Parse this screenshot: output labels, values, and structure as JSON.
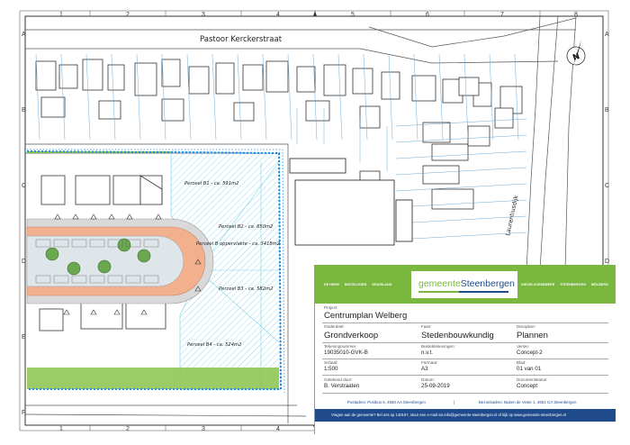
{
  "grid": {
    "cols": [
      "1",
      "2",
      "3",
      "4",
      "5",
      "6",
      "7",
      "8"
    ],
    "rows": [
      "A",
      "B",
      "C",
      "D",
      "E",
      "F"
    ]
  },
  "map": {
    "street_top": "Pastoor Kerckerstraat",
    "street_right": "Laurentiusdijk",
    "north": "N",
    "plots": {
      "b1": "Perceel B1 - ca. 591m2",
      "b2": "Perceel B2 - ca. 650m2",
      "b": "Perceel B oppervlakte - ca. 3418m2",
      "b3": "Perceel B3 - ca. 582m2",
      "b4": "Perceel B4 - ca. 524m2"
    },
    "colors": {
      "plot_outline": "#1e88e5",
      "hatch": "#7fd3e8",
      "green": "#8bc34a",
      "salmon": "#f2b08f"
    }
  },
  "titleblock": {
    "nav_left": [
      "DE HEEN",
      "DINTELOORD",
      "KRUISLAND"
    ],
    "nav_right": [
      "NIEUW-VOSSEMEER",
      "STEENBERGEN",
      "WELBERG"
    ],
    "logo_a": "gemeente",
    "logo_b": "Steenbergen",
    "project_label": "Project:",
    "project": "Centrumplan Welberg",
    "onderdeel_label": "Onderdeel:",
    "onderdeel": "Grondverkoop",
    "fase_label": "Fase:",
    "fase": "Stedenbouwkundig",
    "discipline_label": "Discipline:",
    "discipline": "Plannen",
    "tekening_label": "Tekeningnummer",
    "tekening": "19035010-GVK-B",
    "bestek_label": "Bestektekeningen:",
    "bestek": "n.v.t.",
    "versie_label": "Versie:",
    "versie": "Concept-2",
    "schaal_label": "Schaal:",
    "schaal": "1:500",
    "formaat_label": "Formaat:",
    "formaat": "A3",
    "blad_label": "Blad:",
    "blad": "01 van 01",
    "getekend_label": "Getekend door:",
    "getekend": "B. Verstraaten",
    "datum_label": "Datum:",
    "datum": "25-09-2019",
    "status_label": "Documentstatus:",
    "status": "Concept",
    "addr_left": "Postadres: Postbus 6, 4650 AA Steenbergen",
    "addr_sep": "|",
    "addr_right": "Bezoekadres: Buiten de Veste 1, 4651 GA Steenbergen",
    "footer": "Vragen aan de gemeente? Bel ons op 140167, stuur een e-mail via info@gemeente-steenbergen.nl of kijk op www.gemeente-steenbergen.nl"
  }
}
